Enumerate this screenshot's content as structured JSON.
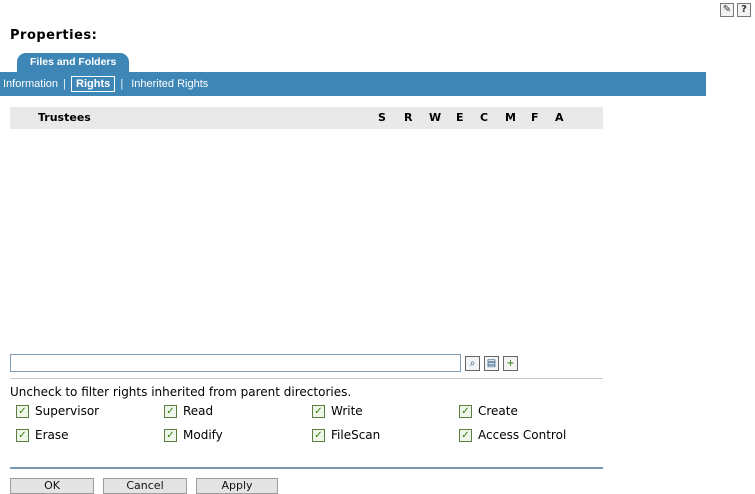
{
  "header": {
    "title": "Properties:",
    "icons": [
      {
        "name": "settings-icon",
        "glyph": "✎"
      },
      {
        "name": "help-icon",
        "glyph": "?"
      }
    ]
  },
  "tab": {
    "label": "Files and Folders"
  },
  "subnav": {
    "items": [
      {
        "label": "Information"
      },
      {
        "label": "Rights"
      },
      {
        "label": "Inherited Rights"
      }
    ]
  },
  "table": {
    "headers": [
      "Trustees",
      "S",
      "R",
      "W",
      "E",
      "C",
      "M",
      "F",
      "A"
    ]
  },
  "search": {
    "value": "",
    "placeholder": ""
  },
  "filter": {
    "text": "Uncheck to filter rights inherited from parent directories.",
    "options": [
      {
        "label": "Supervisor",
        "checked": true
      },
      {
        "label": "Read",
        "checked": true
      },
      {
        "label": "Write",
        "checked": true
      },
      {
        "label": "Create",
        "checked": true
      },
      {
        "label": "Erase",
        "checked": true
      },
      {
        "label": "Modify",
        "checked": true
      },
      {
        "label": "FileScan",
        "checked": true
      },
      {
        "label": "Access Control",
        "checked": true
      }
    ]
  },
  "actions": {
    "ok": "OK",
    "cancel": "Cancel",
    "apply": "Apply"
  },
  "colors": {
    "tab": "#3d86b6",
    "header_bg": "#e9e9e9",
    "checkbox": "#2f7a0b"
  }
}
